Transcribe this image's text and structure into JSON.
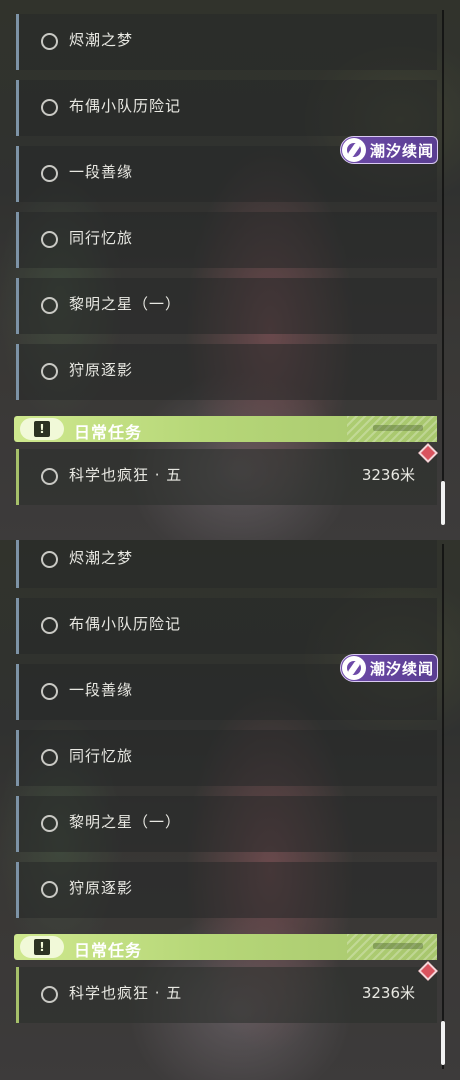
{
  "panels": [
    {
      "quests": [
        {
          "title": "烬潮之梦"
        },
        {
          "title": "布偶小队历险记"
        },
        {
          "title": "一段善缘"
        },
        {
          "title": "同行忆旅"
        },
        {
          "title": "黎明之星（一）"
        },
        {
          "title": "狩原逐影"
        }
      ],
      "tag_label": "潮汐续闻",
      "daily_section_title": "日常任务",
      "daily_quest": {
        "title": "科学也疯狂 · 五",
        "distance": "3236米"
      }
    },
    {
      "quests": [
        {
          "title": "烬潮之梦"
        },
        {
          "title": "布偶小队历险记"
        },
        {
          "title": "一段善缘"
        },
        {
          "title": "同行忆旅"
        },
        {
          "title": "黎明之星（一）"
        },
        {
          "title": "狩原逐影"
        }
      ],
      "tag_label": "潮汐续闻",
      "daily_section_title": "日常任务",
      "daily_quest": {
        "title": "科学也疯狂 · 五",
        "distance": "3236米"
      }
    }
  ],
  "colors": {
    "quest_accent": "#7d93a6",
    "daily_accent": "#b6d778",
    "tag_purple": "#6d4aa8",
    "marker_red": "#d9535e"
  },
  "icons": {
    "quest_status": "circle-outline-icon",
    "daily_header": "exclamation-icon",
    "tag": "tide-emblem-icon",
    "marker": "diamond-marker-icon"
  }
}
